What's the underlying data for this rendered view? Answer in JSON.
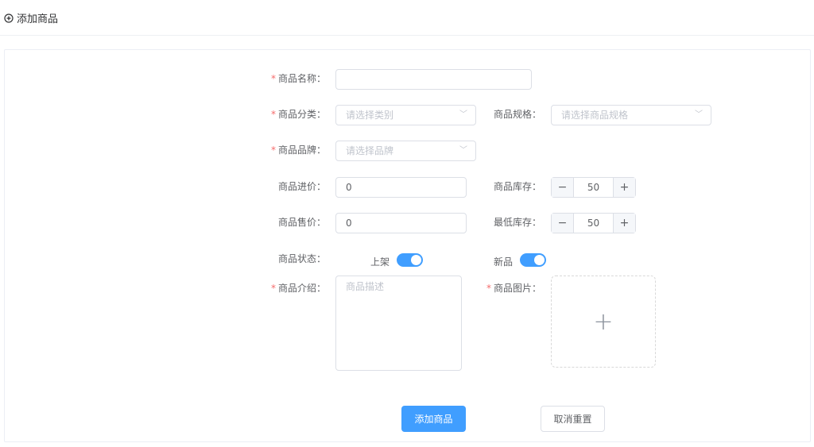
{
  "header": {
    "title": "添加商品",
    "icon": "plus-circle-icon"
  },
  "form": {
    "name": {
      "label": "商品名称：",
      "required": true,
      "value": ""
    },
    "category": {
      "label": "商品分类：",
      "placeholder": "请选择类别"
    },
    "spec": {
      "label": "商品规格：",
      "placeholder": "请选择商品规格"
    },
    "brand": {
      "label": "商品品牌：",
      "placeholder": "请选择品牌"
    },
    "cost": {
      "label": "商品进价：",
      "value": "0"
    },
    "stock": {
      "label": "商品库存：",
      "value": "50",
      "minus": "−",
      "plus": "+"
    },
    "price": {
      "label": "商品售价：",
      "value": "0"
    },
    "min_stock": {
      "label": "最低库存：",
      "value": "50",
      "minus": "−",
      "plus": "+"
    },
    "status": {
      "label": "商品状态：",
      "on_shelf": "上架",
      "on_shelf_enabled": true,
      "new": "新品",
      "new_enabled": true
    },
    "desc": {
      "label": "商品介绍：",
      "placeholder": "商品描述"
    },
    "image": {
      "label": "商品图片：",
      "plus": "+"
    }
  },
  "buttons": {
    "submit": "添加商品",
    "reset": "取消重置"
  },
  "colors": {
    "primary": "#409eff",
    "required": "#f56c6c"
  }
}
